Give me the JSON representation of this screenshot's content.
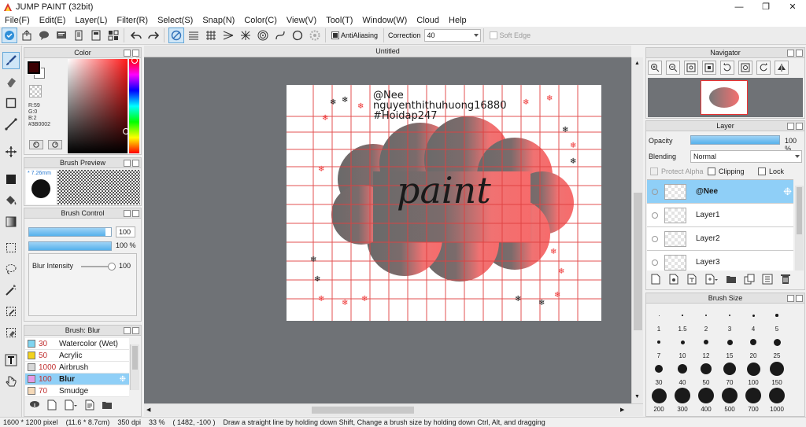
{
  "window": {
    "title": "JUMP PAINT (32bit)"
  },
  "menu": [
    "File(F)",
    "Edit(E)",
    "Layer(L)",
    "Filter(R)",
    "Select(S)",
    "Snap(N)",
    "Color(C)",
    "View(V)",
    "Tool(T)",
    "Window(W)",
    "Cloud",
    "Help"
  ],
  "toolbar": {
    "antialiasing_label": "AntiAliasing",
    "correction_label": "Correction",
    "correction_value": "40",
    "soft_edge_label": "Soft Edge"
  },
  "color_panel": {
    "title": "Color",
    "r": "R:59",
    "g": "G:0",
    "b": "B:2",
    "hex": "#3B0002",
    "main_color": "#3B0002"
  },
  "brush_preview": {
    "title": "Brush Preview",
    "size": "7.26mm"
  },
  "brush_control": {
    "title": "Brush Control",
    "size_value": "100",
    "size_fraction": 0.93,
    "opacity_value": "100 %",
    "opacity_fraction": 1.0,
    "blur_label": "Blur Intensity",
    "blur_value": "100"
  },
  "brush_list": {
    "title": "Brush: Blur",
    "items": [
      {
        "size": "30",
        "name": "Watercolor (Wet)",
        "color": "#7fd4f0"
      },
      {
        "size": "50",
        "name": "Acrylic",
        "color": "#f2d21e"
      },
      {
        "size": "1000",
        "name": "Airbrush",
        "color": "#d7d7d7"
      },
      {
        "size": "100",
        "name": "Blur",
        "color": "#e59ae6",
        "selected": true
      },
      {
        "size": "70",
        "name": "Smudge",
        "color": "#f5d9b8"
      }
    ]
  },
  "document": {
    "tab_title": "Untitled"
  },
  "canvas_art": {
    "watermark_lines": [
      "@Nee",
      "nguyenthithuhuong16880",
      "#Hoidap247"
    ],
    "word": "paint"
  },
  "navigator": {
    "title": "Navigator"
  },
  "layer_panel": {
    "title": "Layer",
    "opacity_label": "Opacity",
    "opacity_value": "100 %",
    "blending_label": "Blending",
    "blending_value": "Normal",
    "protect_alpha_label": "Protect Alpha",
    "clipping_label": "Clipping",
    "lock_label": "Lock",
    "layers": [
      {
        "name": "@Nee",
        "selected": true
      },
      {
        "name": "Layer1"
      },
      {
        "name": "Layer2"
      },
      {
        "name": "Layer3"
      }
    ]
  },
  "brush_size": {
    "title": "Brush Size",
    "sizes": [
      "1",
      "1.5",
      "2",
      "3",
      "4",
      "5",
      "7",
      "10",
      "12",
      "15",
      "20",
      "25",
      "30",
      "40",
      "50",
      "70",
      "100",
      "150",
      "200",
      "300",
      "400",
      "500",
      "700",
      "1000"
    ]
  },
  "status": {
    "doc_size": "1600 * 1200 pixel",
    "physical": "(11.6 * 8.7cm)",
    "dpi": "350 dpi",
    "zoom": "33 %",
    "coords": "( 1482, -100 )",
    "hint": "Draw a straight line by holding down Shift, Change a brush size by holding down Ctrl, Alt, and dragging"
  }
}
